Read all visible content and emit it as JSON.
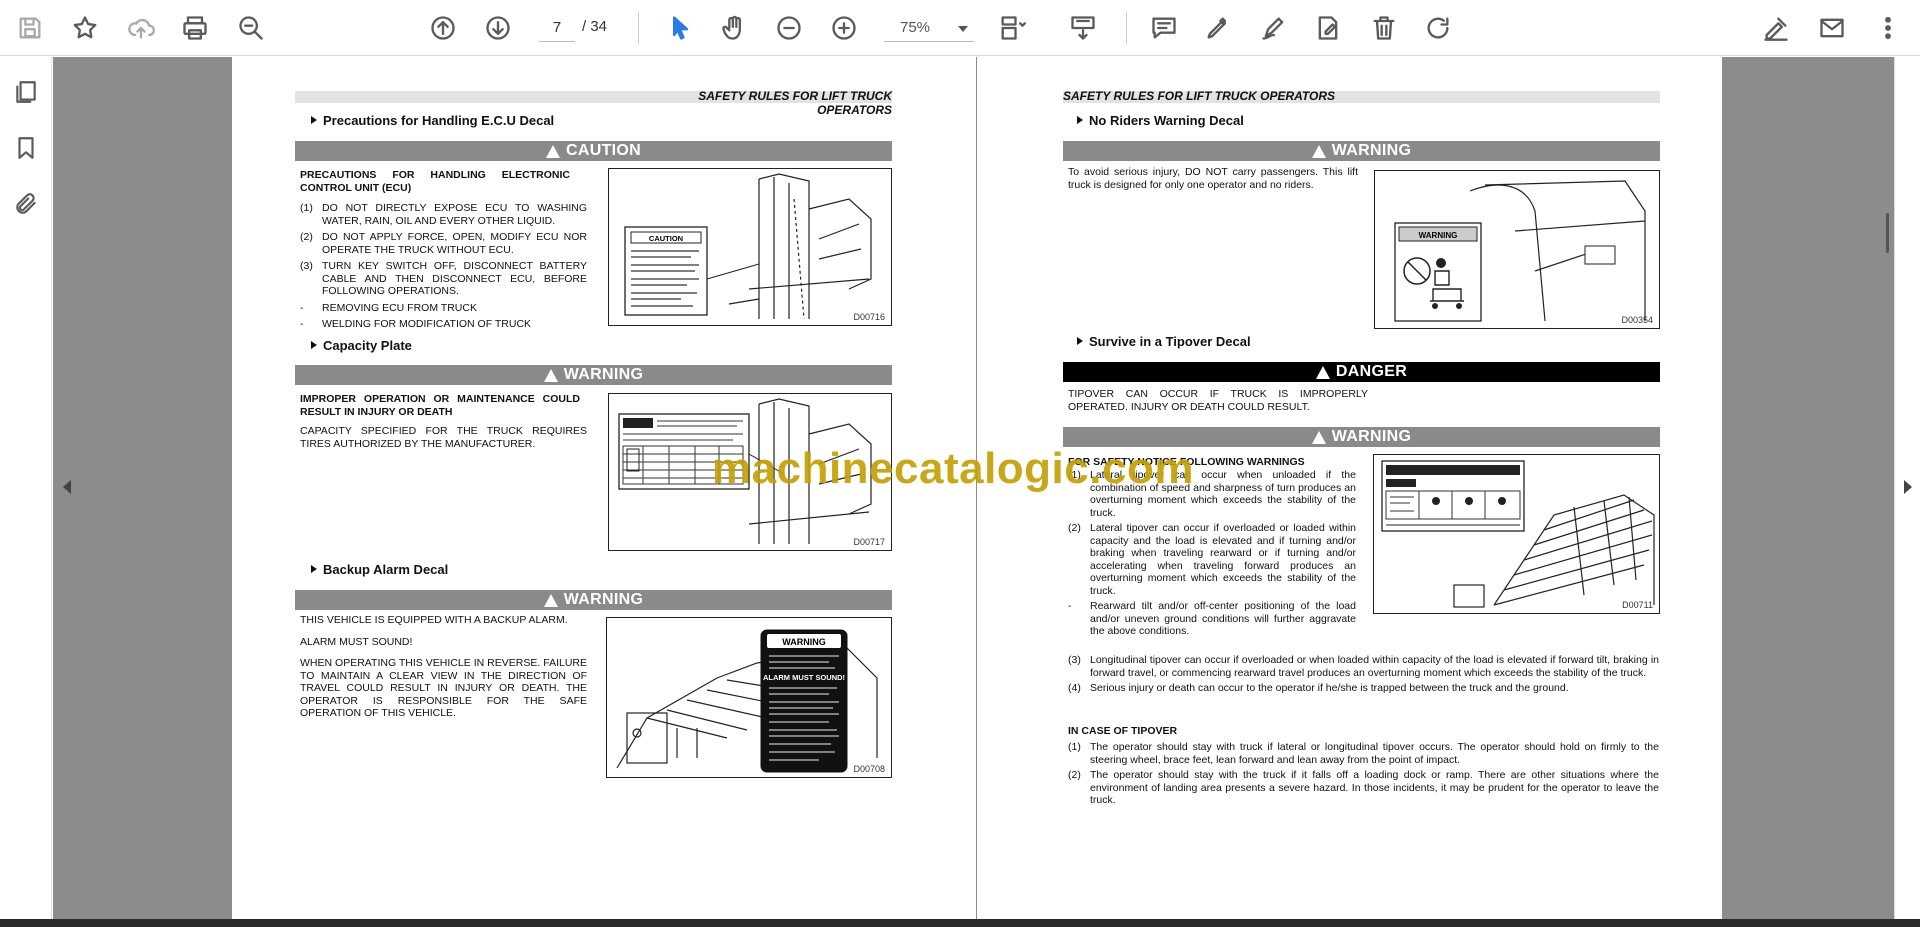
{
  "toolbar": {
    "current_page": "7",
    "total_pages": "/ 34",
    "zoom": "75%",
    "icons": [
      "save-icon",
      "bookmark-star-icon",
      "cloud-upload-icon",
      "print-icon",
      "zoom-search-icon",
      "page-up-icon",
      "page-down-icon",
      "select-cursor-icon",
      "hand-tool-icon",
      "zoom-out-icon",
      "zoom-in-icon",
      "page-fit-icon",
      "scroll-mode-icon",
      "comment-icon",
      "highlight-pen-icon",
      "draw-icon",
      "edit-text-icon",
      "delete-icon",
      "rotate-icon",
      "fill-sign-icon",
      "email-icon",
      "more-icon"
    ]
  },
  "siderail": {
    "icons": [
      "page-thumbnails-icon",
      "bookmarks-icon",
      "attachments-icon"
    ]
  },
  "left_page": {
    "header": "SAFETY RULES FOR LIFT TRUCK OPERATORS",
    "sec1_title": "Precautions for Handling E.C.U Decal",
    "sec1_banner": "CAUTION",
    "sec1_heading": "PRECAUTIONS FOR HANDLING ELECTRONIC CONTROL UNIT (ECU)",
    "sec1_items": [
      {
        "num": "(1)",
        "text": "DO NOT DIRECTLY EXPOSE ECU TO WASHING WATER, RAIN, OIL AND EVERY OTHER LIQUID."
      },
      {
        "num": "(2)",
        "text": "DO NOT APPLY FORCE, OPEN, MODIFY ECU NOR OPERATE THE TRUCK WITHOUT ECU."
      },
      {
        "num": "(3)",
        "text": "TURN KEY SWITCH OFF, DISCONNECT BATTERY CABLE AND THEN DISCONNECT ECU, BEFORE FOLLOWING OPERATIONS."
      },
      {
        "num": "-",
        "text": "REMOVING ECU FROM TRUCK"
      },
      {
        "num": "-",
        "text": "WELDING FOR MODIFICATION OF TRUCK"
      }
    ],
    "sec1_fig": "D00716",
    "sec1_decal": "CAUTION",
    "sec2_title": "Capacity Plate",
    "sec2_banner": "WARNING",
    "sec2_heading": "IMPROPER OPERATION OR MAINTENANCE COULD RESULT IN INJURY OR DEATH",
    "sec2_text": "CAPACITY SPECIFIED FOR THE TRUCK REQUIRES TIRES AUTHORIZED BY THE MANUFACTURER.",
    "sec2_fig": "D00717",
    "sec3_title": "Backup Alarm Decal",
    "sec3_banner": "WARNING",
    "sec3_p1": "THIS VEHICLE IS EQUIPPED WITH A BACKUP ALARM.",
    "sec3_p2": "ALARM MUST SOUND!",
    "sec3_p3": "WHEN OPERATING THIS VEHICLE IN REVERSE. FAILURE TO MAINTAIN A CLEAR VIEW IN THE DIRECTION OF TRAVEL COULD RESULT IN INJURY OR DEATH. THE OPERATOR IS RESPONSIBLE FOR THE SAFE OPERATION OF THIS VEHICLE.",
    "sec3_fig": "D00708",
    "sec3_decal_title": "WARNING",
    "sec3_decal_alarm": "ALARM MUST SOUND!"
  },
  "right_page": {
    "header": "SAFETY RULES FOR LIFT TRUCK OPERATORS",
    "sec1_title": "No Riders Warning Decal",
    "sec1_banner": "WARNING",
    "sec1_text": "To avoid serious injury, DO NOT carry passengers. This lift truck is designed for only one operator and no riders.",
    "sec1_fig": "D00354",
    "sec1_decal": "WARNING",
    "sec2_title": "Survive in a Tipover Decal",
    "sec2_banner": "DANGER",
    "sec2_text": "TIPOVER CAN OCCUR IF TRUCK IS IMPROPERLY OPERATED. INJURY OR DEATH COULD RESULT.",
    "sec3_banner": "WARNING",
    "sec3_heading": "FOR SAFETY NOTICE FOLLOWING WARNINGS",
    "sec3_items": [
      {
        "num": "(1)",
        "text": "Lateral tipover can occur when unloaded if the combination of speed and sharpness of turn produces an overturning moment which exceeds the stability of the truck."
      },
      {
        "num": "(2)",
        "text": "Lateral tipover can occur if overloaded or loaded within capacity and the load is elevated and if turning and/or braking when traveling rearward or if turning and/or accelerating when traveling forward produces an overturning moment which exceeds the stability of the truck."
      },
      {
        "num": "-",
        "text": "Rearward tilt and/or off-center positioning of the load and/or uneven ground conditions will further aggravate the above conditions."
      }
    ],
    "sec3_fig": "D00711",
    "sec3_items_wide": [
      {
        "num": "(3)",
        "text": "Longitudinal tipover can occur if overloaded or when loaded within capacity of the load is elevated if forward tilt, braking in forward travel, or commencing rearward travel produces an overturning moment which exceeds the stability of the truck."
      },
      {
        "num": "(4)",
        "text": "Serious injury or death can occur to the operator if he/she is trapped between the truck and the ground."
      }
    ],
    "sec4_heading": "IN CASE OF TIPOVER",
    "sec4_items": [
      {
        "num": "(1)",
        "text": "The operator should stay with truck if lateral or longitudinal tipover occurs. The operator should hold on firmly to the steering wheel, brace feet, lean forward and lean away from the point of impact."
      },
      {
        "num": "(2)",
        "text": "The operator should stay with the truck if it falls off a loading dock or ramp. There are other situations where the environment of landing area presents a severe hazard. In those incidents, it may be prudent for the operator to leave the truck."
      }
    ]
  },
  "watermark": "machinecatalogic.com"
}
